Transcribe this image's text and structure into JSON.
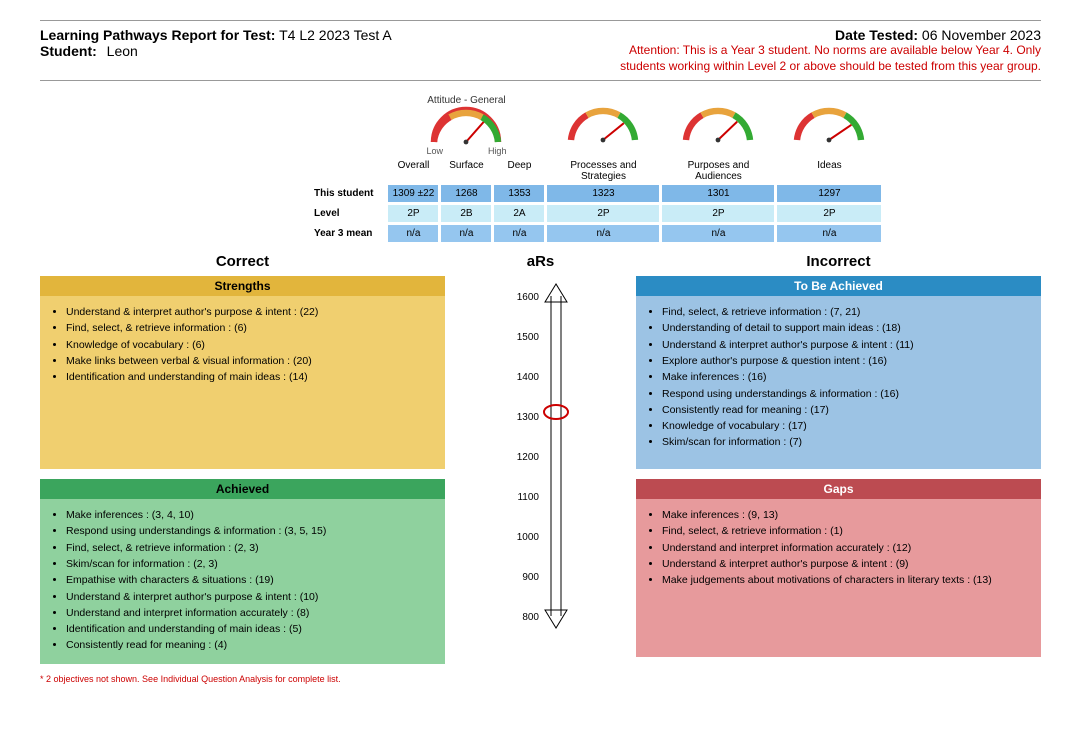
{
  "header": {
    "title_prefix": "Learning Pathways Report for Test:",
    "test_name": "T4 L2 2023 Test A",
    "date_prefix": "Date Tested:",
    "date_value": "06 November 2023",
    "student_prefix": "Student:",
    "student_name": "Leon",
    "warning_line1": "Attention: This is a Year 3 student. No norms are available below Year 4. Only",
    "warning_line2": "students working within Level 2 or above should be tested from this year group."
  },
  "gauge": {
    "title": "Attitude - General",
    "low": "Low",
    "high": "High"
  },
  "table": {
    "cols": [
      "Overall",
      "Surface",
      "Deep",
      "Processes and Strategies",
      "Purposes and Audiences",
      "Ideas"
    ],
    "rows": {
      "this_student": {
        "label": "This student",
        "vals": [
          "1309 ±22",
          "1268",
          "1353",
          "1323",
          "1301",
          "1297"
        ]
      },
      "level": {
        "label": "Level",
        "vals": [
          "2P",
          "2B",
          "2A",
          "2P",
          "2P",
          "2P"
        ]
      },
      "year3": {
        "label": "Year 3 mean",
        "vals": [
          "n/a",
          "n/a",
          "n/a",
          "n/a",
          "n/a",
          "n/a"
        ]
      }
    }
  },
  "sections": {
    "correct": "Correct",
    "ars": "aRs",
    "incorrect": "Incorrect"
  },
  "panels": {
    "strengths": {
      "title": "Strengths",
      "items": [
        "Understand & interpret author's purpose & intent : (22)",
        "Find, select, & retrieve information : (6)",
        "Knowledge of vocabulary : (6)",
        "Make links between verbal & visual information : (20)",
        "Identification and understanding of main ideas : (14)"
      ]
    },
    "achieved": {
      "title": "Achieved",
      "items": [
        "Make inferences : (3, 4, 10)",
        "Respond using understandings & information : (3, 5, 15)",
        "Find, select, & retrieve information : (2, 3)",
        "Skim/scan for information : (2, 3)",
        "Empathise with characters & situations : (19)",
        "Understand & interpret author's purpose & intent : (10)",
        "Understand and interpret information accurately : (8)",
        "Identification and understanding of main ideas : (5)",
        "Consistently read for meaning : (4)"
      ]
    },
    "tba": {
      "title": "To Be Achieved",
      "items": [
        "Find, select, & retrieve information : (7, 21)",
        "Understanding of detail to support main ideas : (18)",
        "Understand & interpret author's purpose & intent : (11)",
        "Explore author's purpose & question intent : (16)",
        "Make inferences : (16)",
        "Respond using understandings & information : (16)",
        "Consistently read for meaning : (17)",
        "Knowledge of vocabulary : (17)",
        "Skim/scan for information : (7)"
      ]
    },
    "gaps": {
      "title": "Gaps",
      "items": [
        "Make inferences : (9, 13)",
        "Find, select, & retrieve information : (1)",
        "Understand and interpret information accurately : (12)",
        "Understand & interpret author's purpose & intent : (9)",
        "Make judgements about motivations of characters in literary texts : (13)"
      ]
    }
  },
  "scale": {
    "ticks": [
      "1600",
      "1500",
      "1400",
      "1300",
      "1200",
      "1100",
      "1000",
      "900",
      "800"
    ],
    "marker": 1309
  },
  "footnote": "* 2 objectives not shown. See Individual Question Analysis for complete list."
}
